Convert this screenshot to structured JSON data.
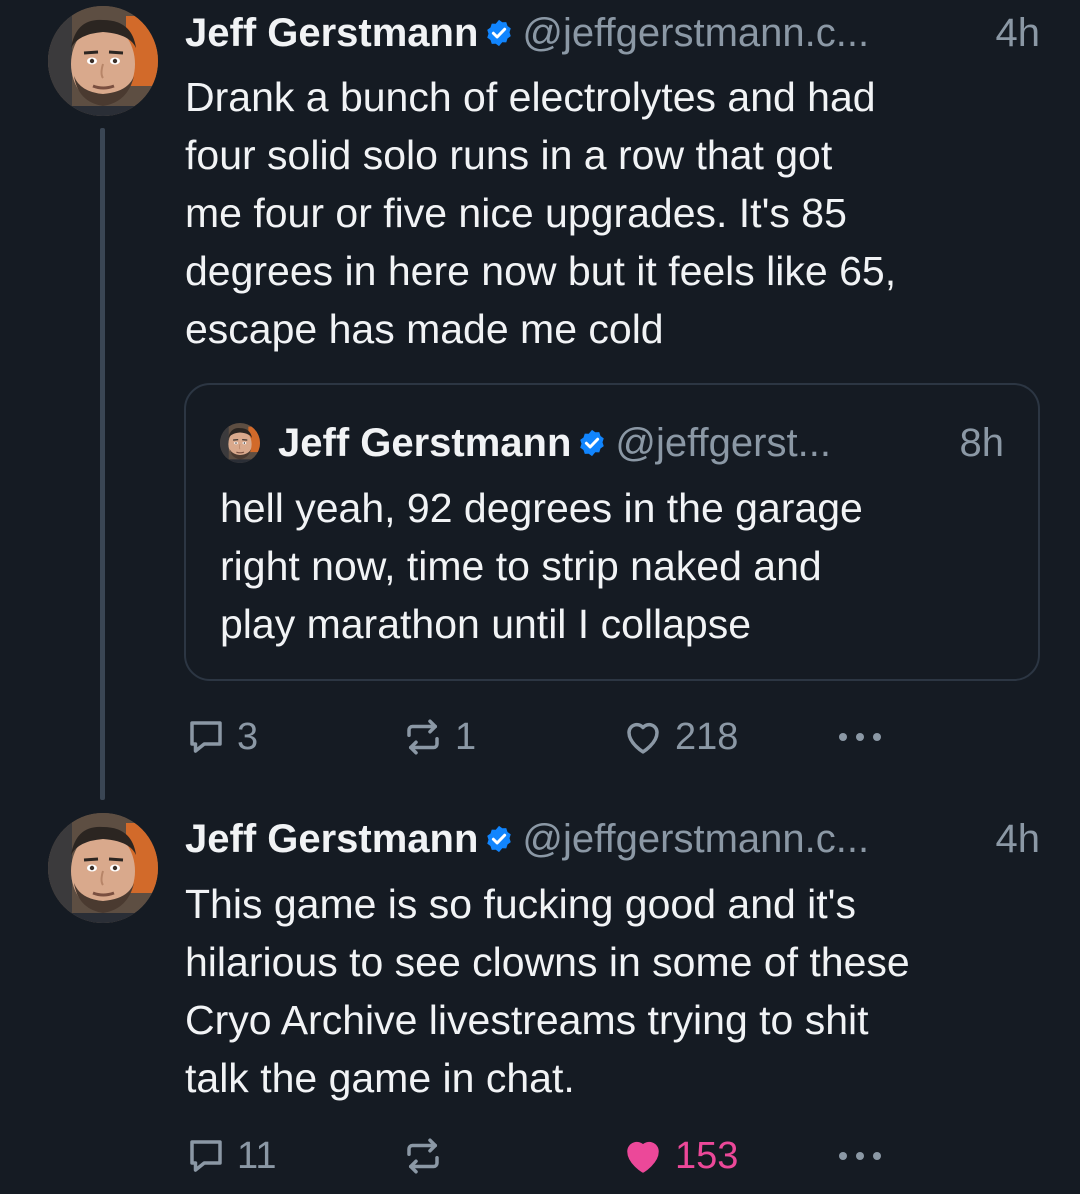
{
  "posts": [
    {
      "author_name": "Jeff Gerstmann",
      "handle": "@jeffgerstmann.c...",
      "time": "4h",
      "text_lines": [
        "Drank a bunch of electrolytes and had",
        "four solid solo runs in a row that got",
        "me four or five nice upgrades. It's 85",
        "degrees in here now but it feels like 65,",
        "escape has made me cold"
      ],
      "quote": {
        "author_name": "Jeff Gerstmann",
        "handle": "@jeffgerst...",
        "time": "8h",
        "text_lines": [
          "hell yeah, 92 degrees in the garage",
          "right now, time to strip naked and",
          "play marathon until I collapse"
        ]
      },
      "replies": "3",
      "reposts": "1",
      "likes": "218",
      "liked": false
    },
    {
      "author_name": "Jeff Gerstmann",
      "handle": "@jeffgerstmann.c...",
      "time": "4h",
      "text_lines": [
        "This game is so fucking good and it's",
        "hilarious to see clowns in some of these",
        "Cryo Archive livestreams trying to shit",
        "talk the game in chat."
      ],
      "replies": "11",
      "reposts": "",
      "likes": "153",
      "liked": true
    }
  ],
  "icons": {
    "reply": "speech-bubble-icon",
    "repost": "repost-arrows-icon",
    "like": "heart-icon",
    "more": "ellipsis-icon",
    "verified": "verified-checkmark-icon"
  },
  "colors": {
    "background": "#151b23",
    "text": "#f1f3f5",
    "muted": "#8b98a5",
    "verified": "#1185fe",
    "like": "#ec4899"
  }
}
